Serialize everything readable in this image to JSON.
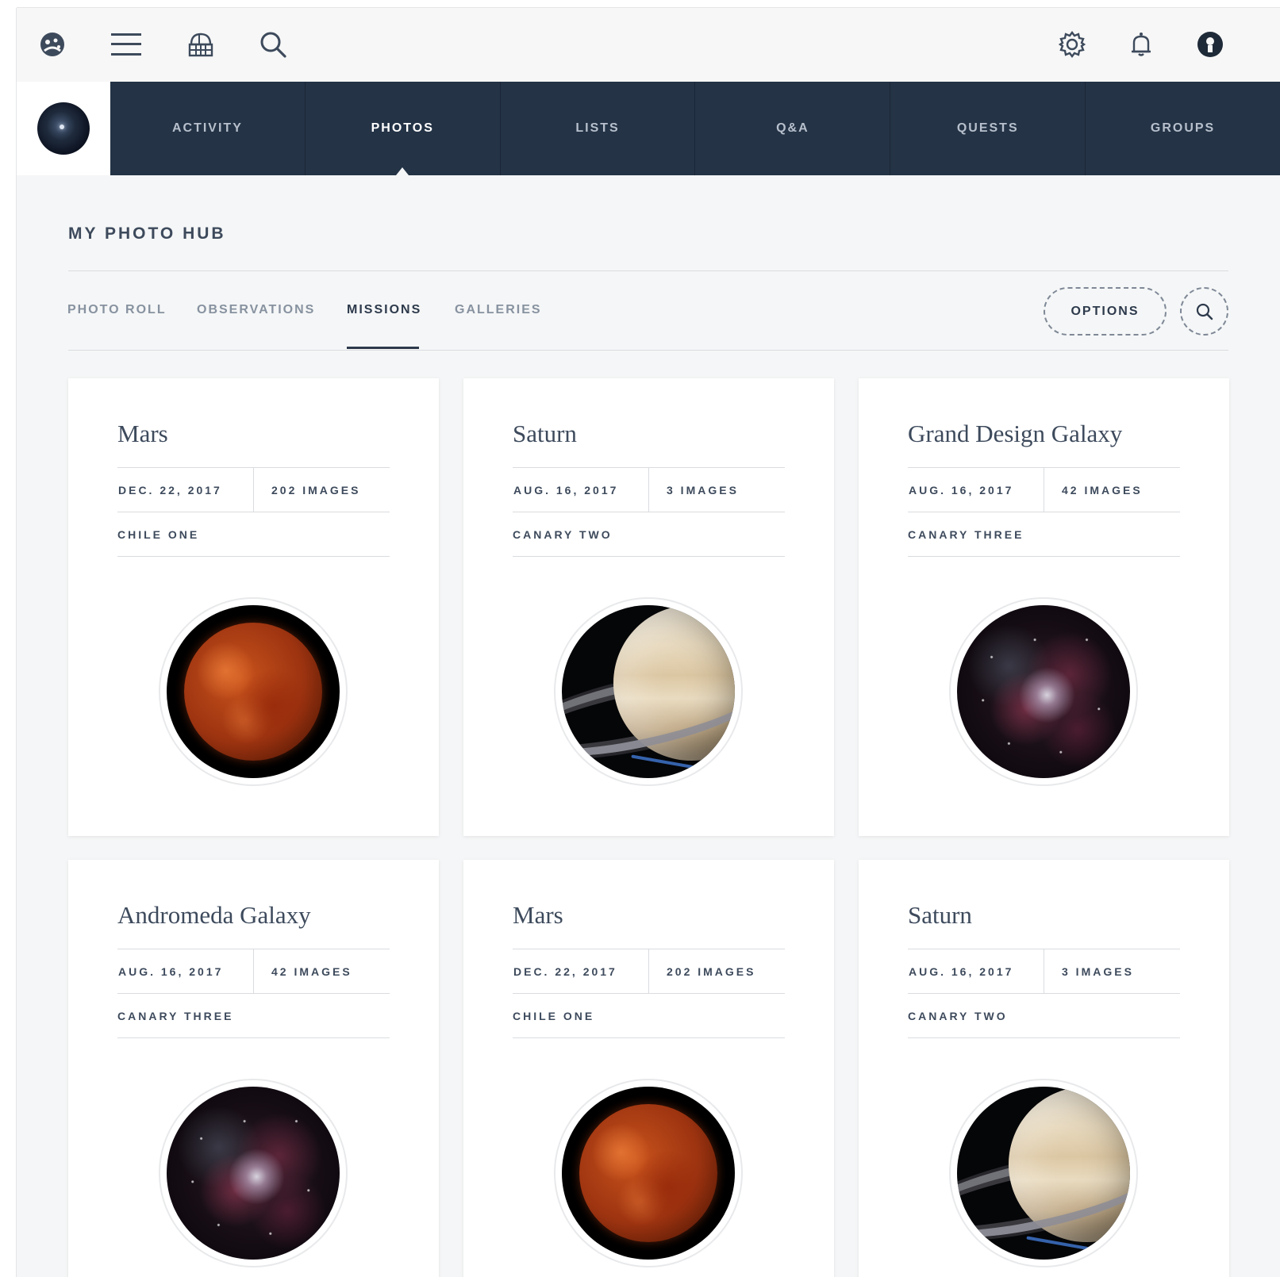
{
  "topbar": {
    "icons": [
      "logo-icon",
      "menu-icon",
      "observatory-icon",
      "search-icon",
      "gear-icon",
      "bell-icon",
      "user-icon"
    ]
  },
  "nav": {
    "tabs": [
      {
        "label": "ACTIVITY",
        "name": "nav-tab-activity"
      },
      {
        "label": "PHOTOS",
        "name": "nav-tab-photos",
        "active": true
      },
      {
        "label": "LISTS",
        "name": "nav-tab-lists"
      },
      {
        "label": "Q&A",
        "name": "nav-tab-qa"
      },
      {
        "label": "QUESTS",
        "name": "nav-tab-quests"
      },
      {
        "label": "GROUPS",
        "name": "nav-tab-groups"
      }
    ]
  },
  "hub": {
    "title": "MY PHOTO HUB",
    "subtabs": [
      {
        "label": "PHOTO ROLL"
      },
      {
        "label": "OBSERVATIONS"
      },
      {
        "label": "MISSIONS",
        "active": true
      },
      {
        "label": "GALLERIES"
      }
    ],
    "options_label": "OPTIONS"
  },
  "missions": [
    {
      "title": "Mars",
      "date": "DEC. 22, 2017",
      "images": "202 IMAGES",
      "telescope": "CHILE ONE",
      "thumb": "mars"
    },
    {
      "title": "Saturn",
      "date": "AUG. 16, 2017",
      "images": "3 IMAGES",
      "telescope": "CANARY TWO",
      "thumb": "saturn"
    },
    {
      "title": "Grand Design Galaxy",
      "date": "AUG. 16, 2017",
      "images": "42 IMAGES",
      "telescope": "CANARY THREE",
      "thumb": "galaxy"
    },
    {
      "title": "Andromeda Galaxy",
      "date": "AUG. 16, 2017",
      "images": "42 IMAGES",
      "telescope": "CANARY THREE",
      "thumb": "galaxy"
    },
    {
      "title": "Mars",
      "date": "DEC. 22, 2017",
      "images": "202 IMAGES",
      "telescope": "CHILE ONE",
      "thumb": "mars"
    },
    {
      "title": "Saturn",
      "date": "AUG. 16, 2017",
      "images": "3 IMAGES",
      "telescope": "CANARY TWO",
      "thumb": "saturn"
    }
  ],
  "colors": {
    "nav_bg": "#243346",
    "text": "#3d4a5c",
    "muted": "#8792a0",
    "page_bg": "#f5f6f7"
  }
}
